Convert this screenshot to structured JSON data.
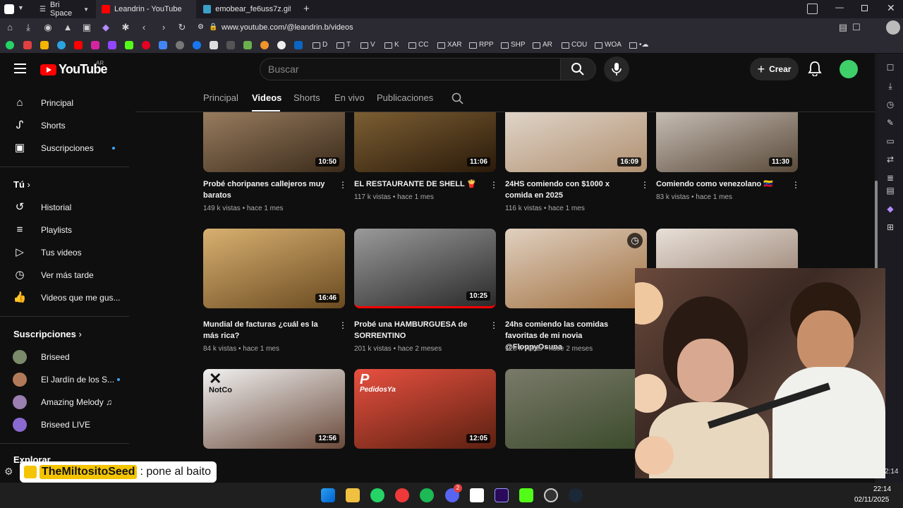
{
  "browser": {
    "profile_label": "Bri Space",
    "tabs": [
      {
        "title": "Leandrin - YouTube"
      },
      {
        "title": "emobear_fe6uss7z.gif (300×"
      }
    ],
    "url": "www.youtube.com/@leandrin.b/videos",
    "bookmarks": [
      "D",
      "T",
      "V",
      "K",
      "CC",
      "XAR",
      "RPP",
      "SHP",
      "AR",
      "COU",
      "WOA"
    ]
  },
  "yt": {
    "logo_text": "YouTube",
    "region": "AR",
    "search_placeholder": "Buscar",
    "create_label": "Crear",
    "sidebar": {
      "main": [
        {
          "label": "Principal",
          "icon": "home-icon"
        },
        {
          "label": "Shorts",
          "icon": "shorts-icon"
        },
        {
          "label": "Suscripciones",
          "icon": "subscriptions-icon"
        }
      ],
      "you_header": "Tú",
      "you": [
        {
          "label": "Historial",
          "icon": "history-icon"
        },
        {
          "label": "Playlists",
          "icon": "playlists-icon"
        },
        {
          "label": "Tus videos",
          "icon": "your-videos-icon"
        },
        {
          "label": "Ver más tarde",
          "icon": "watch-later-icon"
        },
        {
          "label": "Videos que me gus...",
          "icon": "liked-icon"
        }
      ],
      "subs_header": "Suscripciones",
      "subs": [
        {
          "label": "Briseed",
          "color": "#7a8a6a"
        },
        {
          "label": "El Jardín de los S...",
          "color": "#b07a5a"
        },
        {
          "label": "Amazing Melody ♫",
          "color": "#9a7fb0"
        },
        {
          "label": "Briseed LIVE",
          "color": "#8a6ad0"
        }
      ],
      "explore_header": "Explorar"
    },
    "channel_tabs": [
      "Principal",
      "Videos",
      "Shorts",
      "En vivo",
      "Publicaciones"
    ],
    "videos": [
      {
        "title": "Probé choripanes callejeros muy baratos",
        "meta": "149 k vistas • hace 1 mes",
        "duration": "10:50",
        "color": "#7a5a3a"
      },
      {
        "title": "EL RESTAURANTE DE SHELL 🍟",
        "meta": "117 k vistas • hace 1 mes",
        "duration": "11:06",
        "color": "#6a4a2a"
      },
      {
        "title": "24HS comiendo con $1000 x comida en 2025",
        "meta": "116 k vistas • hace 1 mes",
        "duration": "16:09",
        "color": "#c8b49a"
      },
      {
        "title": "Comiendo como venezolano 🇻🇪",
        "meta": "83 k vistas • hace 1 mes",
        "duration": "11:30",
        "color": "#8a7a6a"
      },
      {
        "title": "Mundial de facturas ¿cuál es la más rica?",
        "meta": "84 k vistas • hace 1 mes",
        "duration": "16:46",
        "color": "#c8a060"
      },
      {
        "title": "Probé una HAMBURGUESA de SORRENTINO",
        "meta": "201 k vistas • hace 2 meses",
        "duration": "10:25",
        "color": "#4a4a4a"
      },
      {
        "title": "24hs comiendo las comidas favoritas de mi novia @FloppyOsuna",
        "meta": "128 k vistas • hace 2 meses",
        "duration": "",
        "color": "#b89a80"
      },
      {
        "title": "",
        "meta": "",
        "duration": "",
        "color": "#d8c8b8"
      },
      {
        "title": "",
        "meta": "",
        "duration": "12:56",
        "color": "#8a8a8a",
        "brand": "NotCo"
      },
      {
        "title": "",
        "meta": "",
        "duration": "12:05",
        "color": "#8a3a2a",
        "brand": "PedidosYa"
      },
      {
        "title": "",
        "meta": "",
        "duration": "",
        "color": "#6a7a4a"
      }
    ]
  },
  "overlay": {
    "chat_user": "TheMiltositoSeed",
    "chat_message": ": pone al baito",
    "time_small": "2:14"
  },
  "taskbar": {
    "time": "22:14",
    "date": "02/11/2025",
    "badge": "2"
  },
  "colors": {
    "yt_red": "#ff0000",
    "bg": "#0f0f0f",
    "accent_blue": "#3ea6ff"
  }
}
